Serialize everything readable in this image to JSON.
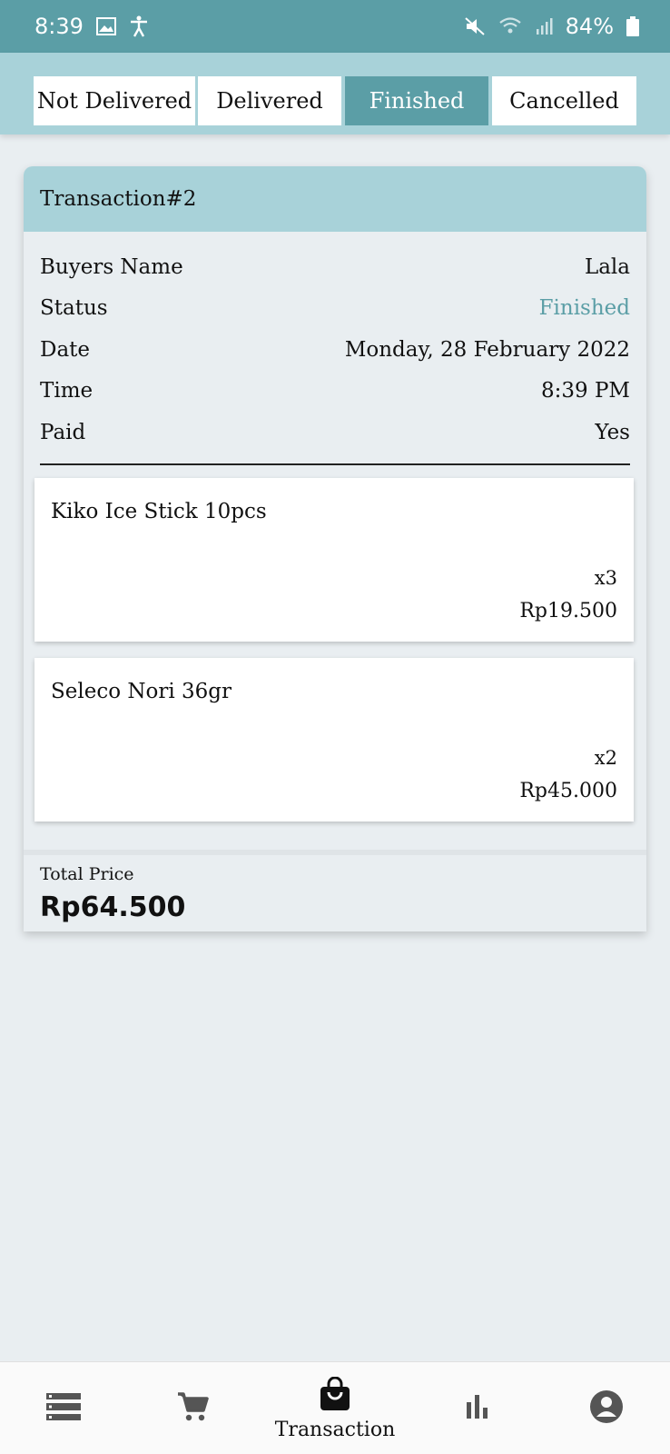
{
  "status_bar": {
    "time": "8:39",
    "battery": "84%"
  },
  "tabs": [
    {
      "label": "Not Delivered",
      "active": false
    },
    {
      "label": "Delivered",
      "active": false
    },
    {
      "label": "Finished",
      "active": true
    },
    {
      "label": "Cancelled",
      "active": false
    }
  ],
  "transaction": {
    "title": "Transaction#2",
    "fields": [
      {
        "label": "Buyers Name",
        "value": "Lala"
      },
      {
        "label": "Status",
        "value": "Finished"
      },
      {
        "label": "Date",
        "value": "Monday, 28 February 2022"
      },
      {
        "label": "Time",
        "value": "8:39 PM"
      },
      {
        "label": "Paid",
        "value": "Yes"
      }
    ],
    "items": [
      {
        "name": "Kiko Ice Stick 10pcs",
        "qty": "x3",
        "price": "Rp19.500"
      },
      {
        "name": "Seleco Nori 36gr",
        "qty": "x2",
        "price": "Rp45.000"
      }
    ],
    "total_label": "Total Price",
    "total_value": "Rp64.500"
  },
  "bottom_nav": {
    "items": [
      {
        "icon": "list-icon",
        "label": ""
      },
      {
        "icon": "cart-icon",
        "label": ""
      },
      {
        "icon": "shopping-bag-icon",
        "label": "Transaction"
      },
      {
        "icon": "bar-chart-icon",
        "label": ""
      },
      {
        "icon": "account-icon",
        "label": ""
      }
    ]
  },
  "colors": {
    "accent": "#5b9ea6",
    "tab_strip": "#a8d2d9",
    "background": "#e9eef1"
  }
}
